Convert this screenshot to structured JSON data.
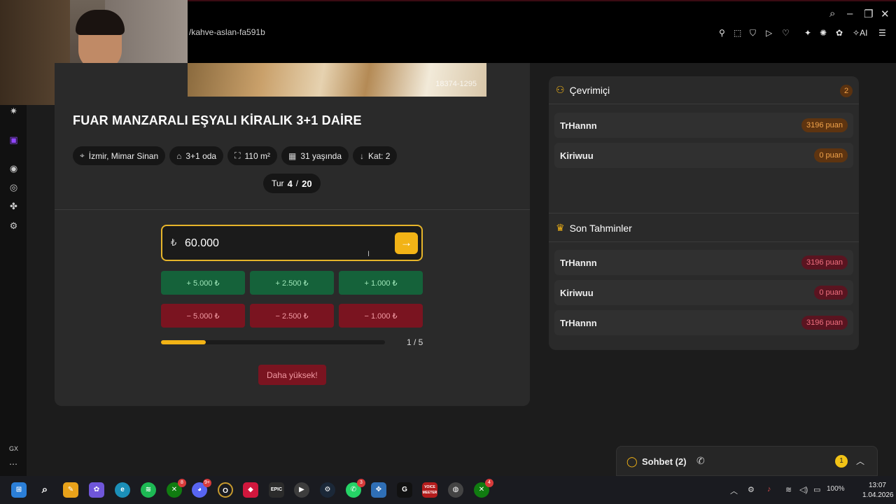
{
  "browser": {
    "url": "/kahve-aslan-fa591b",
    "ai_label": "AI",
    "window_controls": [
      "search-icon",
      "minimize-icon",
      "restore-icon",
      "close-icon"
    ]
  },
  "listing": {
    "photo_id": "18374-1295",
    "title": "FUAR MANZARALI EŞYALI KİRALIK 3+1 DAİRE",
    "tags": [
      {
        "icon": "location-pin-icon",
        "label": "İzmir, Mimar Sinan"
      },
      {
        "icon": "home-icon",
        "label": "3+1 oda"
      },
      {
        "icon": "area-icon",
        "label": "110 m²"
      },
      {
        "icon": "building-icon",
        "label": "31 yaşında"
      },
      {
        "icon": "arrow-down-icon",
        "label": "Kat: 2"
      }
    ]
  },
  "round": {
    "label": "Tur",
    "current": "4",
    "separator": "/",
    "total": "20"
  },
  "guess": {
    "currency": "₺",
    "value": "60.000",
    "increments": [
      "+ 5.000 ₺",
      "+ 2.500 ₺",
      "+ 1.000 ₺"
    ],
    "decrements": [
      "− 5.000 ₺",
      "− 2.500 ₺",
      "− 1.000 ₺"
    ],
    "attempt_fraction": 0.2,
    "attempts_label": "1 / 5",
    "hint": "Daha yüksek!"
  },
  "online": {
    "title": "Çevrimiçi",
    "count": "2",
    "players": [
      {
        "name": "TrHannn",
        "points": "3196 puan"
      },
      {
        "name": "Kiriwuu",
        "points": "0 puan"
      }
    ]
  },
  "recent": {
    "title": "Son Tahminler",
    "items": [
      {
        "name": "TrHannn",
        "points": "3196 puan"
      },
      {
        "name": "Kiriwuu",
        "points": "0 puan"
      },
      {
        "name": "TrHannn",
        "points": "3196 puan"
      }
    ]
  },
  "chat": {
    "label": "Sohbet (2)",
    "unread": "1"
  },
  "sidebar": {
    "gx_label": "GX"
  },
  "taskbar": {
    "badges": {
      "xbox": "8",
      "discord": "9+",
      "whatsapp": "3",
      "xbox2": "4"
    },
    "epic_label": "EPIC",
    "voicemeeter_label": "VOICE MEETER",
    "battery": "100%",
    "time": "13:07",
    "date": "1.04.2026"
  },
  "colors": {
    "accent": "#f2b316",
    "plus": "#15623a",
    "minus": "#7a1420",
    "panel": "#2a2a2a"
  }
}
